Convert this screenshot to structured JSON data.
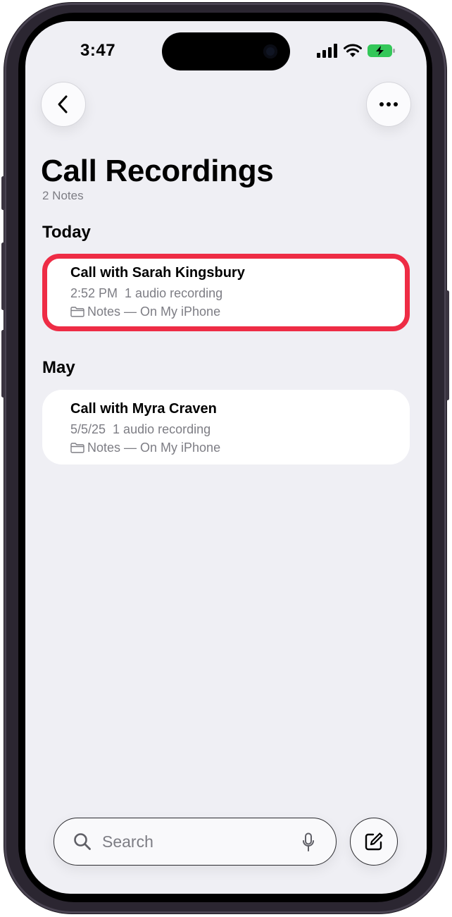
{
  "status_bar": {
    "time": "3:47",
    "icons": [
      "cellular-signal-icon",
      "wifi-icon",
      "battery-charging-icon"
    ]
  },
  "nav": {
    "back_icon": "chevron-left-icon",
    "more_icon": "ellipsis-icon"
  },
  "header": {
    "title": "Call Recordings",
    "subtitle": "2 Notes"
  },
  "sections": [
    {
      "header": "Today",
      "notes": [
        {
          "title": "Call with Sarah Kingsbury",
          "date": "2:52 PM",
          "detail": "1 audio recording",
          "folder": "Notes — On My iPhone",
          "highlighted": true
        }
      ]
    },
    {
      "header": "May",
      "notes": [
        {
          "title": "Call with Myra Craven",
          "date": "5/5/25",
          "detail": "1 audio recording",
          "folder": "Notes — On My iPhone",
          "highlighted": false
        }
      ]
    }
  ],
  "search": {
    "placeholder": "Search"
  },
  "colors": {
    "highlight": "#ee2c45",
    "background": "#efeff4",
    "battery_charging": "#34c759"
  }
}
